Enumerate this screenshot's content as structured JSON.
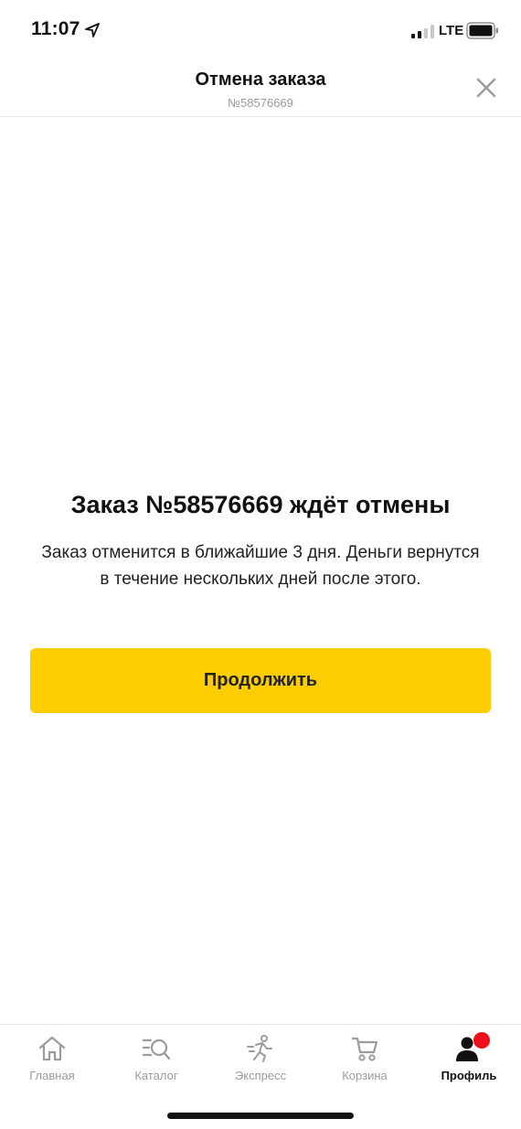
{
  "status_bar": {
    "time": "11:07",
    "network": "LTE"
  },
  "header": {
    "title": "Отмена заказа",
    "subtitle": "№58576669",
    "close_icon": "close-icon"
  },
  "main": {
    "title": "Заказ №58576669 ждёт отмены",
    "description": "Заказ отменится в ближайшие 3 дня. Деньги вернутся в течение нескольких дней после этого.",
    "continue_label": "Продолжить"
  },
  "bottom_nav": {
    "items": [
      {
        "label": "Главная",
        "icon": "home-icon"
      },
      {
        "label": "Каталог",
        "icon": "catalog-search-icon"
      },
      {
        "label": "Экспресс",
        "icon": "express-runner-icon"
      },
      {
        "label": "Корзина",
        "icon": "cart-icon"
      },
      {
        "label": "Профиль",
        "icon": "profile-icon",
        "active": true
      }
    ]
  },
  "colors": {
    "accent": "#fdcd00",
    "badge": "#ef0f1a",
    "inactive": "#9b9b9b"
  }
}
